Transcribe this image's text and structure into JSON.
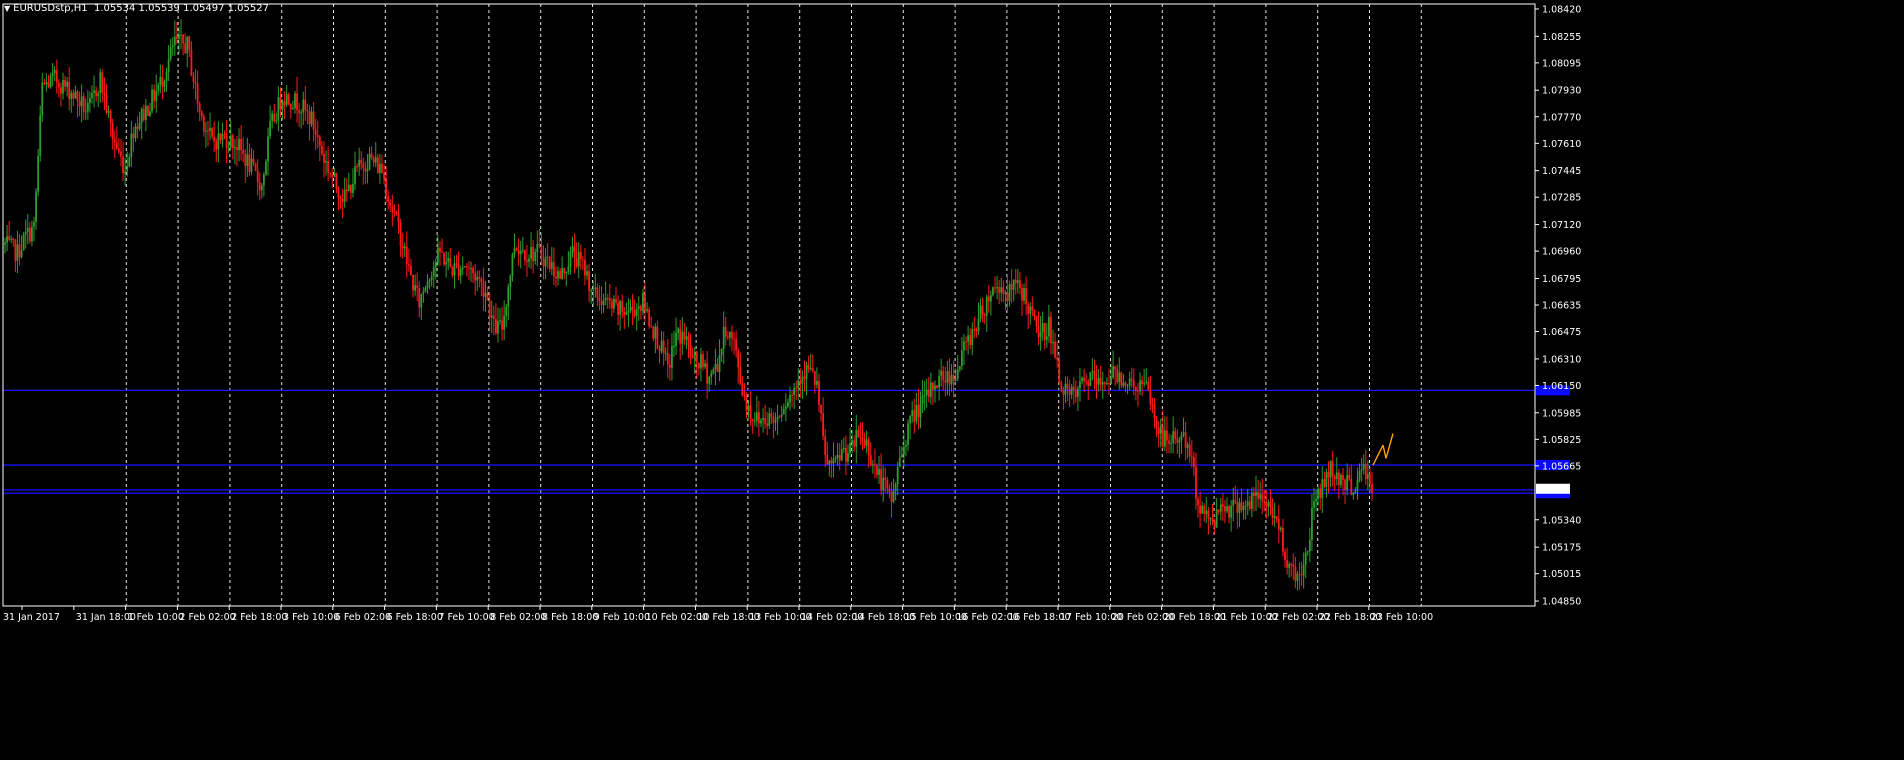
{
  "window": {
    "symbol_label": "EURUSDstp,H1",
    "ohlc_label": "1.05534 1.05539 1.05497 1.05527",
    "menu_arrow": "▼"
  },
  "colors": {
    "background": "#000000",
    "bull": "#2e9e2e",
    "bear": "#ff1a1a",
    "grid": "#ffffff",
    "axis": "#ffffff",
    "hline": "#1414ff",
    "hline_label_bg": "#0a0aff",
    "projection": "#ffa500"
  },
  "chart_data": {
    "type": "candlestick",
    "symbol": "EURUSDstp",
    "timeframe": "H1",
    "ylim": [
      1.0482,
      1.0845
    ],
    "y_ticks": [
      "1.08420",
      "1.08255",
      "1.08095",
      "1.07930",
      "1.07770",
      "1.07610",
      "1.07445",
      "1.07285",
      "1.07120",
      "1.06960",
      "1.06795",
      "1.06635",
      "1.06475",
      "1.06310",
      "1.06150",
      "1.05985",
      "1.05825",
      "1.05665",
      "1.05340",
      "1.05175",
      "1.05015",
      "1.04850"
    ],
    "x_ticks": [
      "31 Jan 2017",
      "31 Jan 18:00",
      "1 Feb 10:00",
      "2 Feb 02:00",
      "2 Feb 18:00",
      "3 Feb 10:00",
      "6 Feb 02:00",
      "6 Feb 18:00",
      "7 Feb 10:00",
      "8 Feb 02:00",
      "8 Feb 18:00",
      "9 Feb 10:00",
      "10 Feb 02:00",
      "10 Feb 18:00",
      "13 Feb 10:00",
      "14 Feb 02:00",
      "14 Feb 18:00",
      "15 Feb 10:00",
      "16 Feb 02:00",
      "16 Feb 18:00",
      "17 Feb 10:00",
      "20 Feb 02:00",
      "20 Feb 18:00",
      "21 Feb 10:00",
      "22 Feb 02:00",
      "22 Feb 18:00",
      "23 Feb 10:00"
    ],
    "grid": true,
    "horizontal_lines": [
      1.0612,
      1.0567,
      1.0552,
      1.055
    ],
    "close_price": 1.05527,
    "projection": [
      [
        1.0567,
        1.0579
      ],
      [
        1.0579,
        1.0571
      ],
      [
        1.0571,
        1.0586
      ]
    ],
    "waypoints": [
      [
        0,
        1.07
      ],
      [
        6,
        1.0695
      ],
      [
        10,
        1.0705
      ],
      [
        14,
        1.071
      ],
      [
        18,
        1.0795
      ],
      [
        24,
        1.08
      ],
      [
        32,
        1.0792
      ],
      [
        40,
        1.078
      ],
      [
        46,
        1.08
      ],
      [
        52,
        1.0765
      ],
      [
        58,
        1.0745
      ],
      [
        62,
        1.077
      ],
      [
        70,
        1.0785
      ],
      [
        76,
        1.08
      ],
      [
        82,
        1.0822
      ],
      [
        88,
        1.082
      ],
      [
        94,
        1.078
      ],
      [
        100,
        1.0762
      ],
      [
        106,
        1.0765
      ],
      [
        112,
        1.076
      ],
      [
        118,
        1.0748
      ],
      [
        124,
        1.0735
      ],
      [
        128,
        1.077
      ],
      [
        134,
        1.079
      ],
      [
        142,
        1.0785
      ],
      [
        148,
        1.0775
      ],
      [
        154,
        1.0752
      ],
      [
        160,
        1.0735
      ],
      [
        164,
        1.0728
      ],
      [
        170,
        1.0745
      ],
      [
        176,
        1.0752
      ],
      [
        182,
        1.0745
      ],
      [
        186,
        1.0725
      ],
      [
        190,
        1.071
      ],
      [
        196,
        1.068
      ],
      [
        200,
        1.0665
      ],
      [
        204,
        1.068
      ],
      [
        210,
        1.0695
      ],
      [
        216,
        1.0685
      ],
      [
        222,
        1.0688
      ],
      [
        228,
        1.068
      ],
      [
        232,
        1.0672
      ],
      [
        236,
        1.065
      ],
      [
        240,
        1.065
      ],
      [
        246,
        1.07
      ],
      [
        252,
        1.0695
      ],
      [
        258,
        1.0695
      ],
      [
        262,
        1.069
      ],
      [
        268,
        1.068
      ],
      [
        274,
        1.0695
      ],
      [
        280,
        1.0685
      ],
      [
        284,
        1.067
      ],
      [
        290,
        1.0665
      ],
      [
        296,
        1.066
      ],
      [
        302,
        1.066
      ],
      [
        308,
        1.0665
      ],
      [
        312,
        1.0652
      ],
      [
        316,
        1.064
      ],
      [
        320,
        1.0625
      ],
      [
        324,
        1.0645
      ],
      [
        328,
        1.0645
      ],
      [
        332,
        1.063
      ],
      [
        336,
        1.0628
      ],
      [
        340,
        1.062
      ],
      [
        344,
        1.0628
      ],
      [
        348,
        1.065
      ],
      [
        352,
        1.064
      ],
      [
        356,
        1.0612
      ],
      [
        360,
        1.0598
      ],
      [
        364,
        1.0594
      ],
      [
        368,
        1.0596
      ],
      [
        372,
        1.0594
      ],
      [
        376,
        1.0605
      ],
      [
        380,
        1.061
      ],
      [
        384,
        1.0622
      ],
      [
        388,
        1.0625
      ],
      [
        392,
        1.0615
      ],
      [
        396,
        1.057
      ],
      [
        400,
        1.0565
      ],
      [
        404,
        1.0575
      ],
      [
        408,
        1.0575
      ],
      [
        412,
        1.0585
      ],
      [
        416,
        1.058
      ],
      [
        420,
        1.0565
      ],
      [
        424,
        1.0555
      ],
      [
        428,
        1.0545
      ],
      [
        432,
        1.057
      ],
      [
        436,
        1.059
      ],
      [
        440,
        1.06
      ],
      [
        444,
        1.0605
      ],
      [
        448,
        1.0615
      ],
      [
        452,
        1.062
      ],
      [
        456,
        1.062
      ],
      [
        460,
        1.0625
      ],
      [
        464,
        1.064
      ],
      [
        468,
        1.065
      ],
      [
        472,
        1.066
      ],
      [
        476,
        1.0672
      ],
      [
        480,
        1.0675
      ],
      [
        484,
        1.067
      ],
      [
        488,
        1.0675
      ],
      [
        492,
        1.067
      ],
      [
        496,
        1.0655
      ],
      [
        500,
        1.0645
      ],
      [
        504,
        1.0652
      ],
      [
        508,
        1.0625
      ],
      [
        512,
        1.061
      ],
      [
        516,
        1.0608
      ],
      [
        520,
        1.0615
      ],
      [
        524,
        1.062
      ],
      [
        528,
        1.0615
      ],
      [
        532,
        1.062
      ],
      [
        536,
        1.0622
      ],
      [
        540,
        1.062
      ],
      [
        544,
        1.0615
      ],
      [
        548,
        1.0615
      ],
      [
        552,
        1.0612
      ],
      [
        556,
        1.059
      ],
      [
        560,
        1.0582
      ],
      [
        564,
        1.0582
      ],
      [
        568,
        1.0585
      ],
      [
        572,
        1.0575
      ],
      [
        576,
        1.0545
      ],
      [
        580,
        1.0535
      ],
      [
        584,
        1.0535
      ],
      [
        588,
        1.0545
      ],
      [
        592,
        1.054
      ],
      [
        596,
        1.0545
      ],
      [
        600,
        1.0542
      ],
      [
        604,
        1.0548
      ],
      [
        608,
        1.0545
      ],
      [
        612,
        1.054
      ],
      [
        616,
        1.0525
      ],
      [
        620,
        1.0505
      ],
      [
        624,
        1.05
      ],
      [
        628,
        1.051
      ],
      [
        632,
        1.0545
      ],
      [
        636,
        1.0555
      ],
      [
        640,
        1.0565
      ],
      [
        644,
        1.056
      ],
      [
        648,
        1.0555
      ],
      [
        652,
        1.0555
      ],
      [
        656,
        1.0565
      ],
      [
        660,
        1.0553
      ]
    ]
  }
}
